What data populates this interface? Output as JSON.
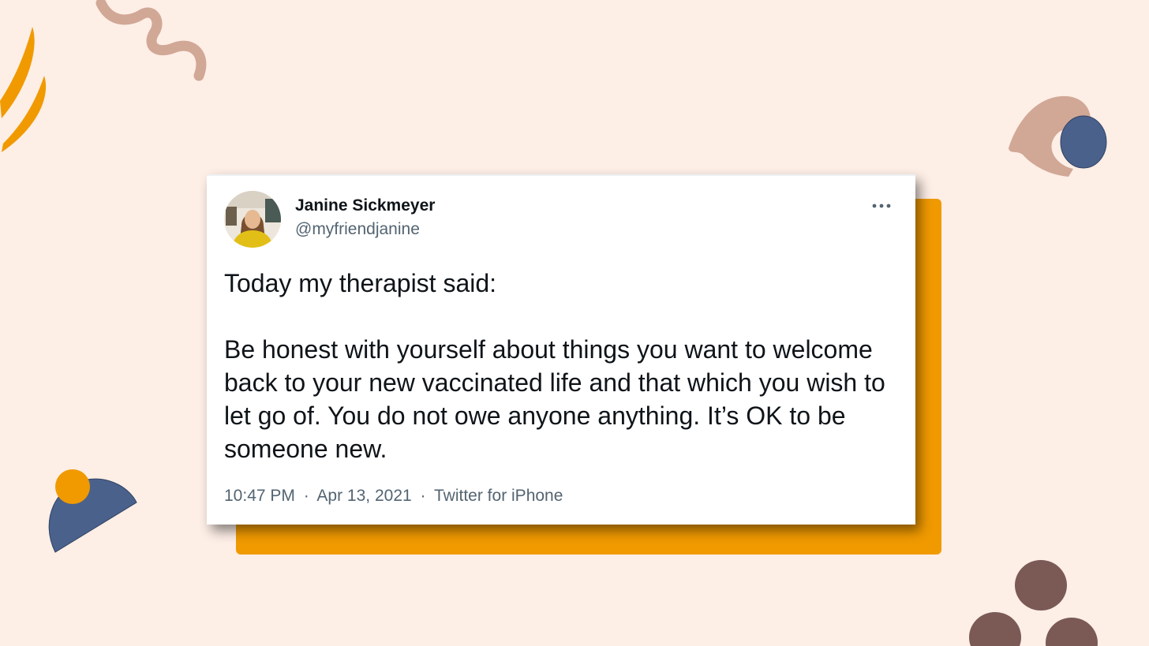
{
  "colors": {
    "background": "#fdeee6",
    "accent_orange": "#f09a00",
    "accent_blue": "#4a618b",
    "accent_tan": "#d1a796",
    "accent_brown": "#7b5a56",
    "text_primary": "#0f1419",
    "text_secondary": "#536471"
  },
  "tweet": {
    "author_name": "Janine Sickmeyer",
    "author_handle": "@myfriendjanine",
    "avatar_icon": "profile-photo",
    "more_icon": "more-horizontal-icon",
    "text_intro": "Today my therapist said:",
    "text_body": "Be honest with yourself about things you want to welcome back to your new vaccinated life and that which you wish to let go of. You do not owe anyone anything. It’s OK to be someone new.",
    "time": "10:47 PM",
    "date": "Apr 13, 2021",
    "source": "Twitter for iPhone",
    "separator": "·"
  }
}
